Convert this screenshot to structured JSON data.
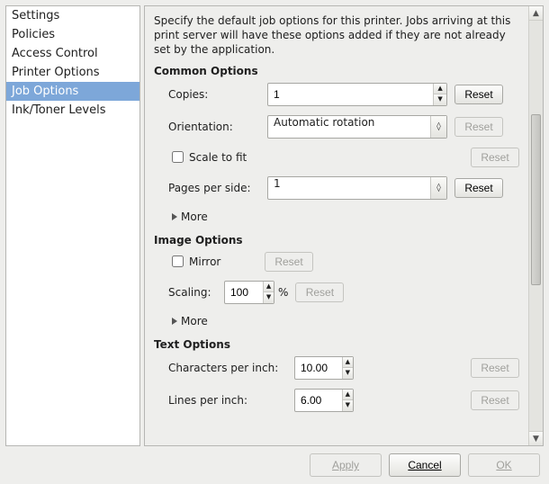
{
  "sidebar": {
    "items": [
      {
        "label": "Settings"
      },
      {
        "label": "Policies"
      },
      {
        "label": "Access Control"
      },
      {
        "label": "Printer Options"
      },
      {
        "label": "Job Options"
      },
      {
        "label": "Ink/Toner Levels"
      }
    ],
    "selected_index": 4
  },
  "content": {
    "description": "Specify the default job options for this printer.  Jobs arriving at this print server will have these options added if they are not already set by the application.",
    "reset_label": "Reset",
    "more_label": "More",
    "common": {
      "heading": "Common Options",
      "copies_label": "Copies:",
      "copies_value": "1",
      "orientation_label": "Orientation:",
      "orientation_value": "Automatic rotation",
      "scale_to_fit_label": "Scale to fit",
      "scale_to_fit_checked": false,
      "pages_per_side_label": "Pages per side:",
      "pages_per_side_value": "1"
    },
    "image": {
      "heading": "Image Options",
      "mirror_label": "Mirror",
      "mirror_checked": false,
      "scaling_label": "Scaling:",
      "scaling_value": "100",
      "scaling_suffix": "%"
    },
    "text": {
      "heading": "Text Options",
      "cpi_label": "Characters per inch:",
      "cpi_value": "10.00",
      "lpi_label": "Lines per inch:",
      "lpi_value": "6.00"
    }
  },
  "footer": {
    "apply": "Apply",
    "cancel": "Cancel",
    "ok": "OK"
  }
}
